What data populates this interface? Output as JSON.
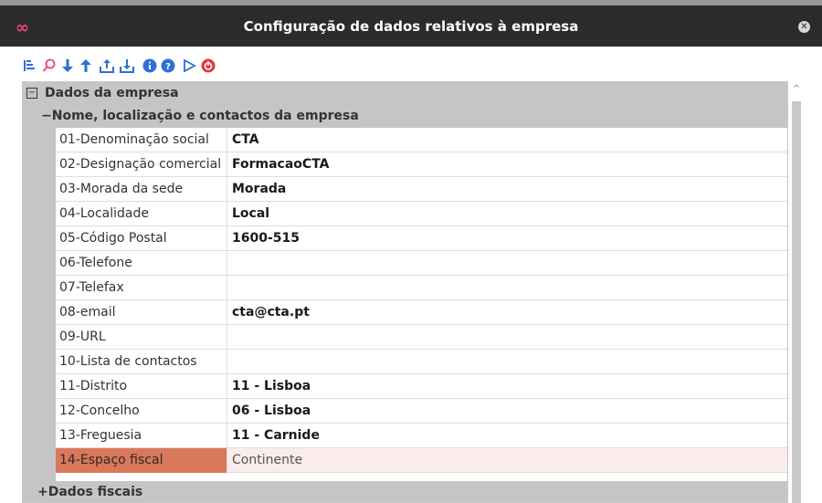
{
  "window": {
    "title": "Configuração de dados relativos à empresa"
  },
  "toolbar": {
    "icons": [
      "sort-icon",
      "search-icon",
      "arrow-down-icon",
      "arrow-up-icon",
      "export-icon",
      "import-icon",
      "info-icon",
      "help-icon",
      "play-icon",
      "power-icon"
    ]
  },
  "tree": {
    "root_label": "Dados da empresa",
    "section_label": "Nome, localização e contactos da empresa",
    "rows": [
      {
        "label": "01-Denominação social",
        "value": "CTA"
      },
      {
        "label": "02-Designação comercial",
        "value": "FormacaoCTA"
      },
      {
        "label": "03-Morada da sede",
        "value": "Morada"
      },
      {
        "label": "04-Localidade",
        "value": "Local"
      },
      {
        "label": "05-Código Postal",
        "value": "1600-515"
      },
      {
        "label": "06-Telefone",
        "value": ""
      },
      {
        "label": "07-Telefax",
        "value": ""
      },
      {
        "label": "08-email",
        "value": "cta@cta.pt"
      },
      {
        "label": "09-URL",
        "value": ""
      },
      {
        "label": "10-Lista de contactos",
        "value": ""
      },
      {
        "label": "11-Distrito",
        "value": "11 - Lisboa"
      },
      {
        "label": "12-Concelho",
        "value": "06 - Lisboa"
      },
      {
        "label": "13-Freguesia",
        "value": "11 - Carnide"
      },
      {
        "label": "14-Espaço fiscal",
        "value": "Continente"
      }
    ],
    "fiscal_label": "Dados fiscais"
  },
  "colors": {
    "selected_label_bg": "#d9785a",
    "category_bg": "#c5c5c5",
    "toolbar_blue": "#2e6fd8",
    "toolbar_red": "#e03a3a"
  }
}
